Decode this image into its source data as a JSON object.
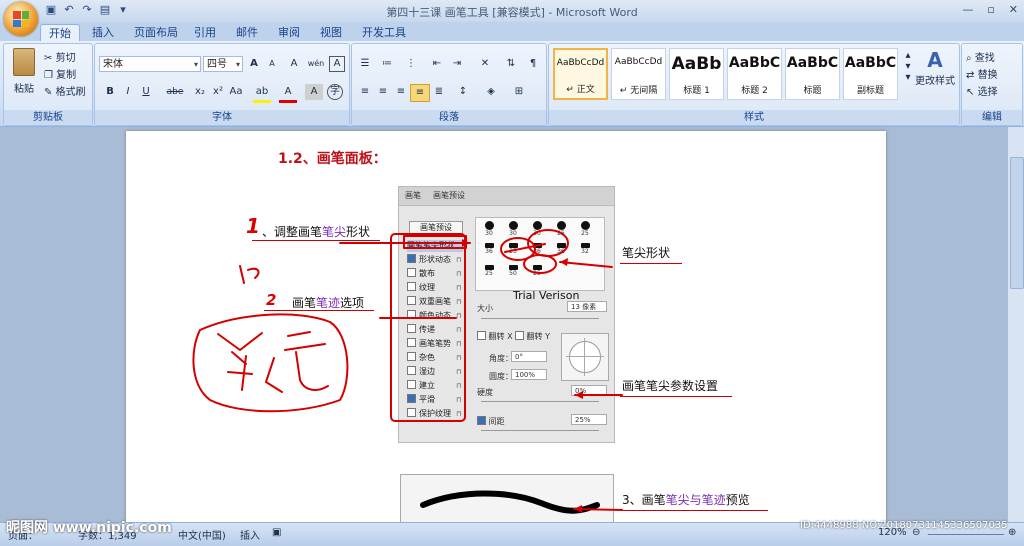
{
  "window": {
    "title": "第四十三课 画笔工具 [兼容模式] - Microsoft Word",
    "controls": [
      "minimize-icon",
      "maximize-icon",
      "close-icon"
    ]
  },
  "quick_access": [
    "save-icon",
    "undo-icon",
    "redo-icon",
    "print-preview-icon",
    "customize-icon"
  ],
  "ribbon_tabs": [
    "开始",
    "插入",
    "页面布局",
    "引用",
    "邮件",
    "审阅",
    "视图",
    "开发工具"
  ],
  "active_tab": "开始",
  "clipboard": {
    "paste": "粘贴",
    "cut": "剪切",
    "copy": "复制",
    "format_painter": "格式刷",
    "label": "剪贴板"
  },
  "font": {
    "face": "宋体",
    "size": "四号",
    "label": "字体",
    "grow": "A",
    "shrink": "A",
    "bold": "B",
    "italic": "I",
    "underline": "U",
    "strike": "abe",
    "subscript": "x₂",
    "superscript": "x²",
    "case": "Aa",
    "highlight": "ab",
    "color": "A",
    "clear_format": "A",
    "char_border": "A",
    "phonetic": "wén"
  },
  "paragraph": {
    "label": "段落"
  },
  "styles": {
    "label": "样式",
    "items": [
      {
        "sample": "AaBbCcDd",
        "name": "↵ 正文",
        "selected": true
      },
      {
        "sample": "AaBbCcDd",
        "name": "↵ 无间隔",
        "selected": false
      },
      {
        "sample": "AaBb",
        "name": "标题 1",
        "selected": false
      },
      {
        "sample": "AaBbC",
        "name": "标题 2",
        "selected": false
      },
      {
        "sample": "AaBbC",
        "name": "标题",
        "selected": false
      },
      {
        "sample": "AaBbC",
        "name": "副标题",
        "selected": false
      }
    ],
    "change_styles": "更改样式"
  },
  "editing": {
    "label": "编辑",
    "find": "查找",
    "replace": "替换",
    "select": "选择"
  },
  "document": {
    "heading": "1.2、画笔面板：",
    "annotations": {
      "adjust_tip_prefix": "、调整画笔",
      "adjust_tip_highlight": "笔尖",
      "adjust_tip_suffix": "形状",
      "stroke_options_prefix": "画笔",
      "stroke_options_highlight": "笔迹",
      "stroke_options_suffix": "选项",
      "tip_shape": "笔尖形状",
      "tip_params": "画笔笔尖参数设置",
      "preview_prefix": "3、画笔",
      "preview_highlight": "笔尖与笔迹",
      "preview_suffix": "预览",
      "handwritten_num1": "1",
      "handwritten_num2": "2"
    },
    "trial_text": "Trial Verison"
  },
  "brush_panel": {
    "tabs": [
      "画笔",
      "画笔预设"
    ],
    "preset_button": "画笔预设",
    "options": [
      {
        "label": "画笔笔尖形状",
        "checked": false,
        "selected": true
      },
      {
        "label": "形状动态",
        "checked": true
      },
      {
        "label": "散布",
        "checked": false
      },
      {
        "label": "纹理",
        "checked": false
      },
      {
        "label": "双重画笔",
        "checked": false
      },
      {
        "label": "颜色动态",
        "checked": false
      },
      {
        "label": "传递",
        "checked": false
      },
      {
        "label": "画笔笔势",
        "checked": false
      },
      {
        "label": "杂色",
        "checked": false
      },
      {
        "label": "湿边",
        "checked": false
      },
      {
        "label": "建立",
        "checked": false
      },
      {
        "label": "平滑",
        "checked": true
      },
      {
        "label": "保护纹理",
        "checked": false
      }
    ],
    "tips": [
      "30",
      "30",
      "30",
      "25",
      "25",
      "36",
      "25",
      "36",
      "36",
      "32",
      "25",
      "50",
      "25"
    ],
    "size_label": "大小",
    "size_value": "13 像素",
    "flip_x": "翻转 X",
    "flip_y": "翻转 Y",
    "angle_label": "角度：",
    "angle_value": "0°",
    "roundness_label": "圆度：",
    "roundness_value": "100%",
    "hardness_label": "硬度",
    "hardness_value": "0%",
    "spacing_label": "间距",
    "spacing_value": "25%",
    "spacing_checked": true
  },
  "statusbar": {
    "page": "页面：",
    "words": "字数：1,349",
    "language": "中文(中国)",
    "insert": "插入",
    "zoom": "120%"
  },
  "watermark": {
    "left": "昵图网 www.nipic.com",
    "right": "ID:4448988 NO:20180731145336507035"
  },
  "colors": {
    "ribbon_text": "#15428b",
    "annotation_red": "#cc0000",
    "highlight_purple": "#7a2fb5"
  }
}
